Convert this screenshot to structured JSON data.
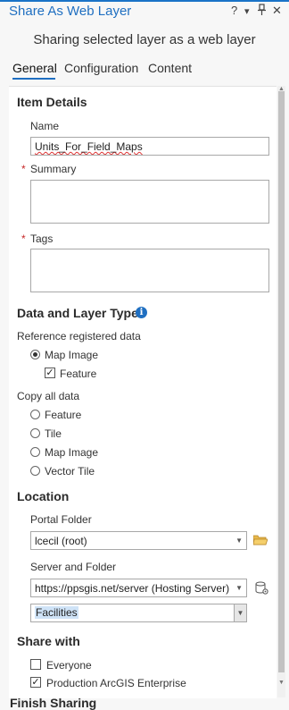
{
  "window": {
    "title": "Share As Web Layer",
    "help": "?",
    "menu": "▾",
    "pin": "ᛖ",
    "close": "✕"
  },
  "subtitle": "Sharing selected layer as a web layer",
  "tabs": [
    {
      "label": "General",
      "active": true
    },
    {
      "label": "Configuration",
      "active": false
    },
    {
      "label": "Content",
      "active": false
    }
  ],
  "item_details": {
    "heading": "Item Details",
    "name_label": "Name",
    "name_value": "Units_For_Field_Maps",
    "summary_label": "Summary",
    "summary_required": "*",
    "summary_value": "",
    "tags_label": "Tags",
    "tags_required": "*",
    "tags_value": ""
  },
  "data_layer_type": {
    "heading": "Data and Layer Type",
    "info_glyph": "i",
    "reference_label": "Reference registered data",
    "reference_options": [
      {
        "label": "Map Image",
        "selected": true
      }
    ],
    "feature_check": {
      "label": "Feature",
      "checked": true,
      "glyph": "✓"
    },
    "copy_label": "Copy all data",
    "copy_options": [
      {
        "label": "Feature",
        "selected": false
      },
      {
        "label": "Tile",
        "selected": false
      },
      {
        "label": "Map Image",
        "selected": false
      },
      {
        "label": "Vector Tile",
        "selected": false
      }
    ]
  },
  "location": {
    "heading": "Location",
    "portal_folder_label": "Portal Folder",
    "portal_folder_value": "lcecil (root)",
    "server_folder_label": "Server and Folder",
    "server_value": "https://ppsgis.net/server (Hosting Server)",
    "folder_value": "Facilities"
  },
  "share_with": {
    "heading": "Share with",
    "options": [
      {
        "label": "Everyone",
        "checked": false
      },
      {
        "label": "Production ArcGIS Enterprise",
        "checked": true
      }
    ]
  },
  "finish_heading": "Finish Sharing",
  "colors": {
    "accent": "#1f6fc1",
    "required": "#c62828",
    "selection": "#cfe3f7",
    "folder_icon": "#e8b84a"
  }
}
